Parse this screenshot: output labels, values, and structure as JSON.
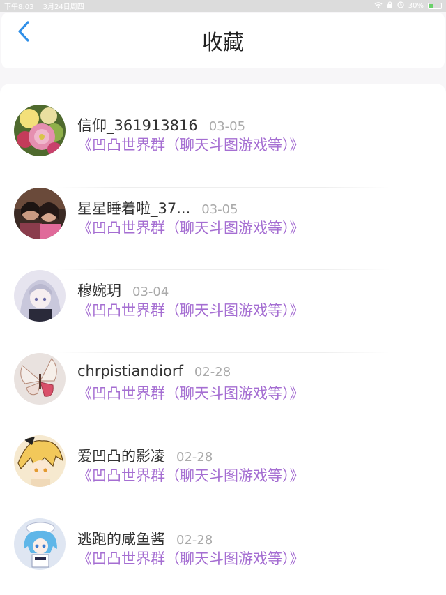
{
  "status_bar": {
    "time": "下午8:03",
    "date": "3月24日周四",
    "battery": "30%"
  },
  "header": {
    "title": "收藏",
    "back_icon": "chevron-left-icon"
  },
  "items": [
    {
      "name": "信仰_361913816",
      "date": "03-05",
      "group": "《凹凸世界群（聊天斗图游戏等）》",
      "avatar": "flowers"
    },
    {
      "name": "星星睡着啦_37...",
      "date": "03-05",
      "group": "《凹凸世界群（聊天斗图游戏等）》",
      "avatar": "photo-two-girls"
    },
    {
      "name": "穆婉玥",
      "date": "03-04",
      "group": "《凹凸世界群（聊天斗图游戏等）》",
      "avatar": "anime-silver-hair"
    },
    {
      "name": "chrpistiandiorf",
      "date": "02-28",
      "group": "《凹凸世界群（聊天斗图游戏等）》",
      "avatar": "butterfly"
    },
    {
      "name": "爱凹凸的影凌",
      "date": "02-28",
      "group": "《凹凸世界群（聊天斗图游戏等）》",
      "avatar": "anime-blonde"
    },
    {
      "name": "逃跑的咸鱼酱",
      "date": "02-28",
      "group": "《凹凸世界群（聊天斗图游戏等）》",
      "avatar": "anime-blue-hair"
    }
  ],
  "colors": {
    "accent": "#2f8fe8",
    "group_text": "#a56ed2",
    "date_text": "#aaaaaa"
  }
}
